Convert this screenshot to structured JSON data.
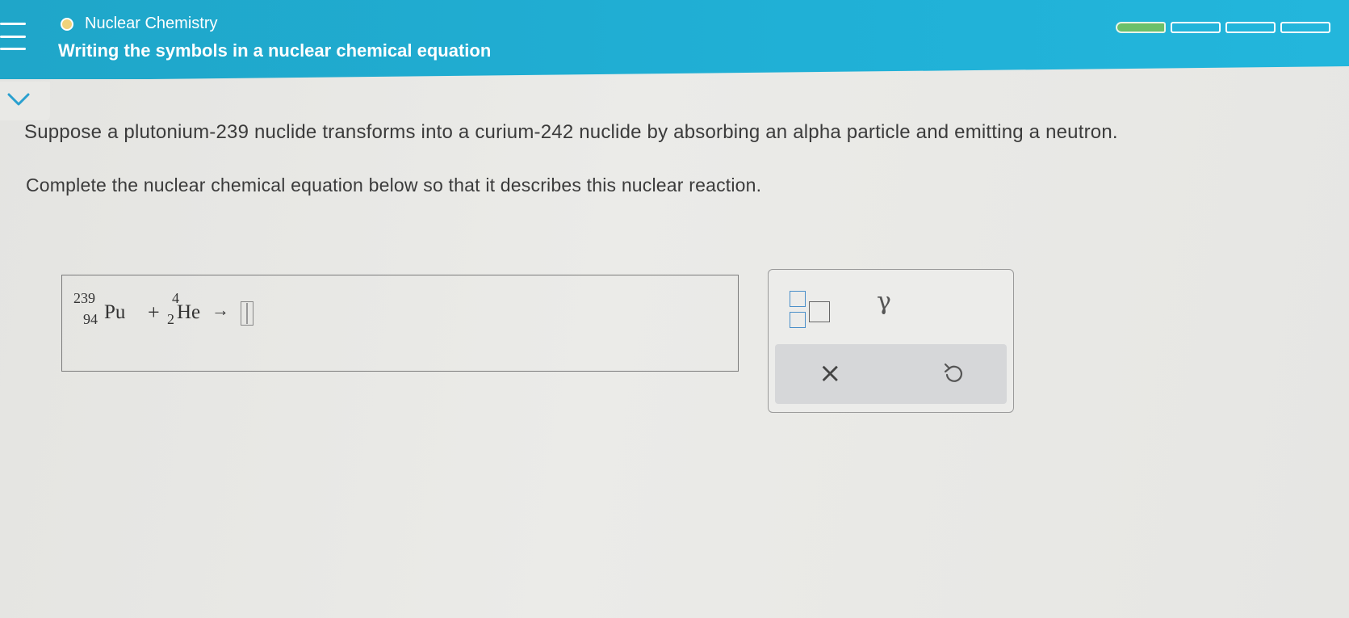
{
  "header": {
    "topic": "Nuclear Chemistry",
    "title": "Writing the symbols in a nuclear chemical equation",
    "progress": {
      "completed_segments": 1,
      "total_segments": 4
    }
  },
  "question": {
    "problem": "Suppose a plutonium-239 nuclide transforms into a curium-242 nuclide by absorbing an alpha particle and emitting a neutron.",
    "instruction": "Complete the nuclear chemical equation below so that it describes this nuclear reaction."
  },
  "equation": {
    "reactant1": {
      "mass": "239",
      "atomic": "94",
      "symbol": "Pu"
    },
    "plus": "+",
    "reactant2": {
      "mass": "4",
      "atomic": "2",
      "symbol": "He"
    },
    "arrow": "→"
  },
  "tools": {
    "gamma": "γ",
    "clear": "×"
  },
  "colors": {
    "header": "#20b0d6",
    "progress_done": "#6cc06a",
    "template_icon": "#4a8fc9"
  }
}
